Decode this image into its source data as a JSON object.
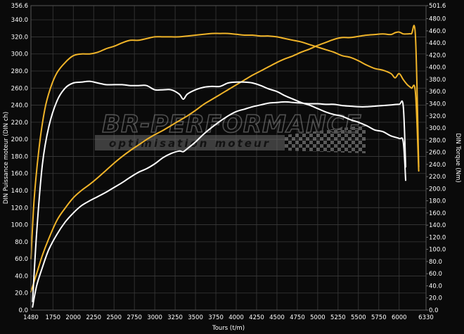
{
  "chart_data": {
    "type": "line",
    "xlabel": "Tours (t/m)",
    "ylabel_left": "DIN Puissance moteur (DIN ch)",
    "ylabel_right": "DIN Torque (Nm)",
    "xlim": [
      1480,
      6330
    ],
    "ylim_left": [
      0.0,
      356.6
    ],
    "ylim_right": [
      0.0,
      501.6
    ],
    "x_ticks": [
      "1480",
      "1750",
      "2000",
      "2250",
      "2500",
      "2750",
      "3000",
      "3250",
      "3500",
      "3750",
      "4000",
      "4250",
      "4500",
      "4750",
      "5000",
      "5250",
      "5500",
      "5750",
      "6000",
      "6330"
    ],
    "y_ticks_left": [
      "0.0",
      "20.0",
      "40.0",
      "60.0",
      "80.0",
      "100.0",
      "120.0",
      "140.0",
      "160.0",
      "180.0",
      "200.0",
      "220.0",
      "240.0",
      "260.0",
      "280.0",
      "300.0",
      "320.0",
      "340.0",
      "356.6"
    ],
    "y_ticks_right": [
      "0.0",
      "20.0",
      "40.0",
      "60.0",
      "80.0",
      "100.0",
      "120.0",
      "140.0",
      "160.0",
      "180.0",
      "200.0",
      "220.0",
      "240.0",
      "260.0",
      "280.0",
      "300.0",
      "320.0",
      "340.0",
      "360.0",
      "380.0",
      "400.0",
      "420.0",
      "440.0",
      "460.0",
      "480.0",
      "501.6"
    ],
    "grid": true,
    "colors": {
      "tuned": "#f0b429",
      "stock": "#ffffff",
      "background": "#0a0a0a",
      "grid": "#3a3a3a"
    },
    "series": [
      {
        "variant": "tuned",
        "axis": "right",
        "color": "#f0b429",
        "x": [
          1480,
          1550,
          1620,
          1700,
          1800,
          1900,
          2000,
          2100,
          2200,
          2300,
          2400,
          2500,
          2600,
          2700,
          2800,
          2900,
          3000,
          3100,
          3200,
          3300,
          3400,
          3500,
          3600,
          3700,
          3800,
          3900,
          4000,
          4100,
          4200,
          4300,
          4400,
          4500,
          4600,
          4700,
          4800,
          4900,
          5000,
          5100,
          5200,
          5300,
          5400,
          5500,
          5600,
          5700,
          5800,
          5900,
          5950,
          6000,
          6050,
          6100,
          6150,
          6200,
          6240
        ],
        "y": [
          30,
          60,
          90,
          118,
          148,
          168,
          185,
          197,
          207,
          218,
          230,
          242,
          253,
          263,
          272,
          281,
          289,
          296,
          304,
          312,
          320,
          329,
          339,
          347,
          355,
          363,
          371,
          379,
          387,
          394,
          401,
          408,
          414,
          419,
          425,
          430,
          436,
          441,
          446,
          449,
          449,
          451,
          453,
          454,
          455,
          454,
          457,
          458,
          455,
          455,
          455,
          452,
          236
        ]
      },
      {
        "variant": "stock",
        "axis": "right",
        "color": "#ffffff",
        "x": [
          1500,
          1550,
          1620,
          1700,
          1800,
          1900,
          2000,
          2100,
          2200,
          2300,
          2400,
          2500,
          2600,
          2700,
          2800,
          2900,
          3000,
          3100,
          3200,
          3300,
          3350,
          3400,
          3500,
          3600,
          3700,
          3800,
          3900,
          4000,
          4100,
          4200,
          4300,
          4400,
          4500,
          4600,
          4700,
          4800,
          4900,
          5000,
          5100,
          5200,
          5300,
          5400,
          5500,
          5600,
          5700,
          5800,
          5900,
          6000,
          6050,
          6080
        ],
        "y": [
          5,
          40,
          70,
          100,
          125,
          145,
          160,
          172,
          180,
          187,
          194,
          202,
          210,
          219,
          227,
          233,
          241,
          251,
          258,
          262,
          261,
          266,
          277,
          290,
          301,
          311,
          320,
          327,
          331,
          335,
          338,
          341,
          342,
          343,
          342,
          341,
          340,
          340,
          339,
          339,
          337,
          336,
          335,
          335,
          336,
          337,
          338,
          339,
          336,
          236
        ]
      },
      {
        "variant": "tuned",
        "axis": "left",
        "color": "#f0b429",
        "x": [
          1480,
          1520,
          1580,
          1650,
          1720,
          1800,
          1900,
          2000,
          2100,
          2200,
          2300,
          2400,
          2500,
          2600,
          2700,
          2800,
          2900,
          3000,
          3100,
          3200,
          3300,
          3400,
          3500,
          3600,
          3700,
          3800,
          3900,
          4000,
          4100,
          4200,
          4300,
          4400,
          4500,
          4600,
          4700,
          4800,
          4900,
          5000,
          5100,
          5200,
          5300,
          5400,
          5500,
          5600,
          5700,
          5800,
          5900,
          5950,
          6000,
          6050,
          6100,
          6150,
          6200,
          6240
        ],
        "y": [
          60,
          130,
          190,
          235,
          260,
          278,
          290,
          298,
          300,
          300,
          302,
          306,
          309,
          313,
          316,
          316,
          318,
          320,
          320,
          320,
          320,
          321,
          322,
          323,
          324,
          324,
          324,
          323,
          322,
          322,
          321,
          321,
          320,
          318,
          316,
          314,
          311,
          308,
          305,
          302,
          298,
          296,
          292,
          287,
          283,
          281,
          277,
          272,
          277,
          270,
          264,
          260,
          255,
          163
        ]
      },
      {
        "variant": "stock",
        "axis": "left",
        "color": "#ffffff",
        "x": [
          1500,
          1550,
          1620,
          1700,
          1800,
          1900,
          2000,
          2100,
          2200,
          2300,
          2400,
          2500,
          2600,
          2700,
          2800,
          2900,
          3000,
          3100,
          3200,
          3300,
          3350,
          3400,
          3500,
          3600,
          3700,
          3800,
          3900,
          4000,
          4100,
          4200,
          4300,
          4400,
          4500,
          4600,
          4700,
          4800,
          4900,
          5000,
          5100,
          5200,
          5300,
          5400,
          5500,
          5600,
          5700,
          5800,
          5900,
          6000,
          6050,
          6080
        ],
        "y": [
          10,
          90,
          170,
          215,
          245,
          260,
          266,
          267,
          268,
          266,
          264,
          264,
          264,
          263,
          263,
          263,
          258,
          258,
          258,
          253,
          247,
          253,
          258,
          261,
          262,
          262,
          266,
          267,
          267,
          266,
          263,
          259,
          256,
          251,
          247,
          243,
          240,
          236,
          232,
          229,
          227,
          223,
          220,
          216,
          211,
          209,
          204,
          201,
          197,
          152
        ]
      }
    ]
  },
  "watermark": {
    "title": "BR-PERFORMANCE",
    "subtitle": "optimisation moteur"
  }
}
